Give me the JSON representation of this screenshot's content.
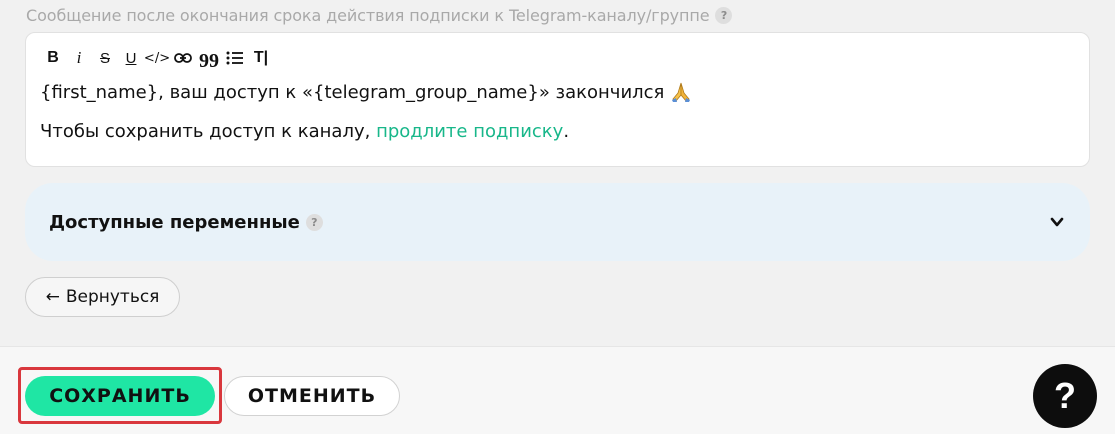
{
  "field": {
    "label": "Сообщение после окончания срока действия подписки к Telegram-каналу/группе",
    "help": "?"
  },
  "toolbar": {
    "bold": "B",
    "italic": "i",
    "strike": "S",
    "underline": "U",
    "code": "</>",
    "quote": "99",
    "clear": "T|"
  },
  "message": {
    "line1": "{first_name}, ваш доступ к «{telegram_group_name}» закончился",
    "line1_emoji": "pray-emoji",
    "line2_before": "Чтобы сохранить доступ к каналу, ",
    "line2_link": "продлите подписку",
    "line2_after": "."
  },
  "variables": {
    "title": "Доступные переменные",
    "help": "?"
  },
  "back": {
    "arrow": "←",
    "label": "Вернуться"
  },
  "footer": {
    "save": "СОХРАНИТЬ",
    "cancel": "ОТМЕНИТЬ",
    "help": "?"
  },
  "colors": {
    "accent": "#1fe6a4",
    "link": "#18b78a",
    "highlight": "#d9373d",
    "panel": "#e8f2f9"
  }
}
